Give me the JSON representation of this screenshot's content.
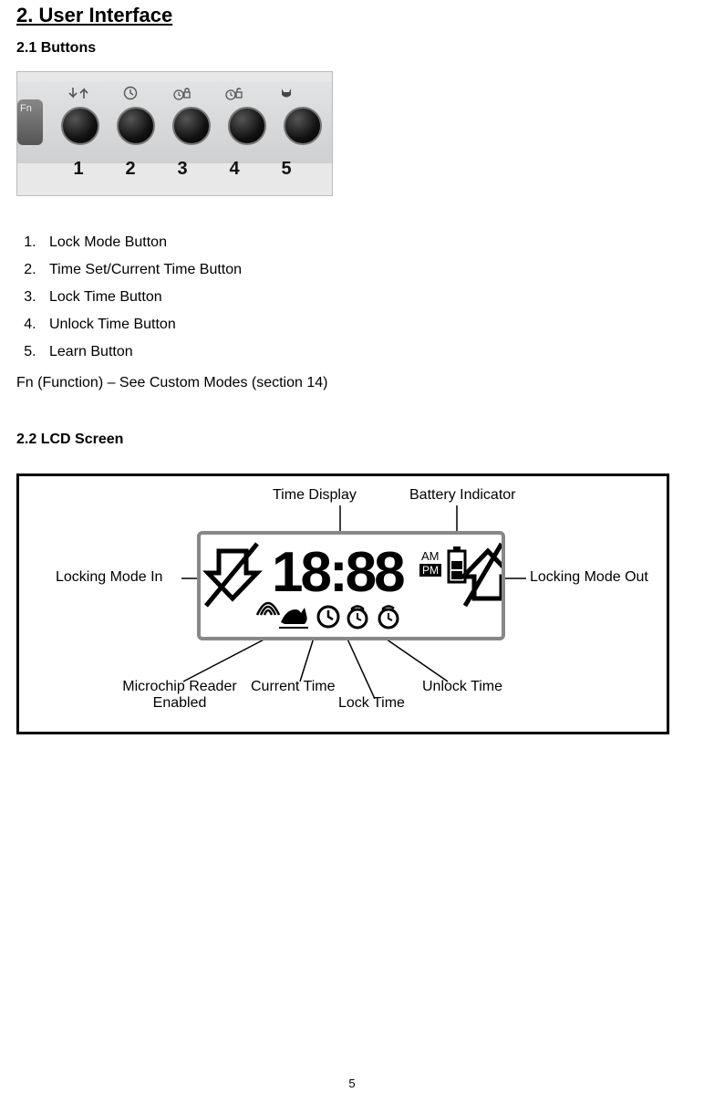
{
  "section_title": "2. User Interface",
  "subsection_buttons": "2.1 Buttons",
  "fn_key": "Fn",
  "button_numbers": [
    "1",
    "2",
    "3",
    "4",
    "5"
  ],
  "button_list": [
    "Lock Mode Button",
    "Time Set/Current Time Button",
    "Lock Time Button",
    "Unlock Time Button",
    "Learn Button"
  ],
  "fn_note": "Fn (Function) – See Custom Modes (section 14)",
  "subsection_lcd": "2.2 LCD Screen",
  "lcd_labels": {
    "time_display": "Time Display",
    "battery": "Battery Indicator",
    "lock_in": "Locking Mode In",
    "lock_out": "Locking Mode Out",
    "microchip_l1": "Microchip Reader",
    "microchip_l2": "Enabled",
    "current_time": "Current Time",
    "lock_time": "Lock Time",
    "unlock_time": "Unlock Time"
  },
  "lcd_digits": "18:88",
  "lcd_am": "AM",
  "lcd_pm": "PM",
  "page_number": "5"
}
